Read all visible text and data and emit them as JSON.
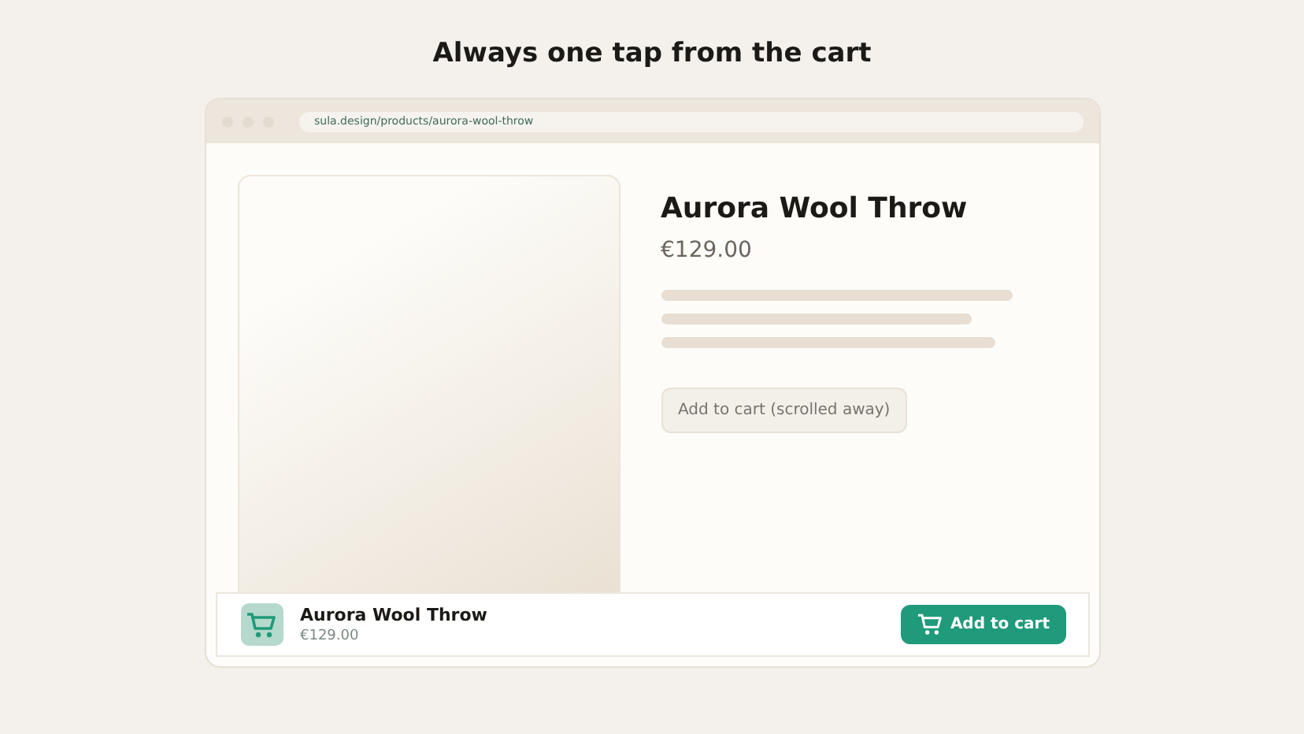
{
  "headline": "Always one tap from the cart",
  "browser": {
    "url": "sula.design/products/aurora-wool-throw"
  },
  "product": {
    "name": "Aurora Wool Throw",
    "price": "€129.00",
    "inline_button": {
      "label": "Add to cart (scrolled away)",
      "disabled": true
    }
  },
  "sticky_bar": {
    "name": "Aurora Wool Throw",
    "price": "€129.00",
    "button": "Add to cart"
  }
}
